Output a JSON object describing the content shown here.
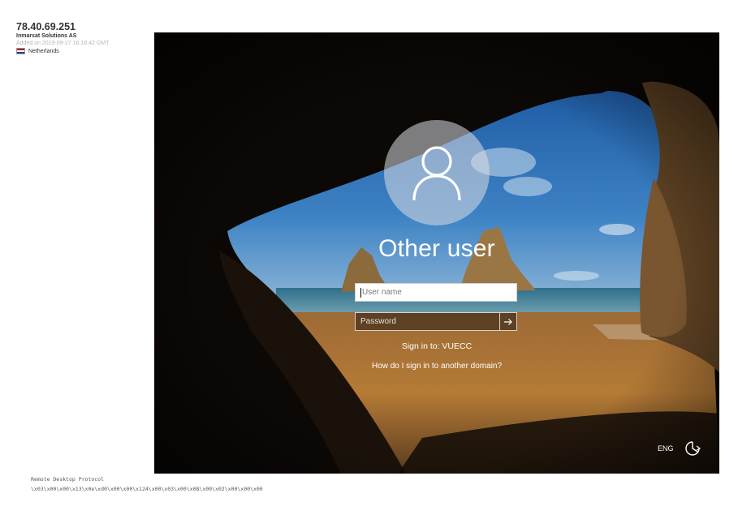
{
  "host": {
    "ip": "78.40.69.251",
    "organization": "Inmarsat Solutions AS",
    "added": "Added on 2019-09-27 16:18:42 GMT",
    "country": "Netherlands",
    "flag_icon": "netherlands-flag-icon"
  },
  "login": {
    "title": "Other user",
    "username_placeholder": "User name",
    "password_placeholder": "Password",
    "submit_icon": "arrow-right-icon",
    "sign_in_to": "Sign in to: VUECC",
    "another_domain": "How do I sign in to another domain?",
    "language": "ENG",
    "accessibility_icon": "ease-of-access-icon",
    "avatar_icon": "user-avatar-icon"
  },
  "footer": {
    "protocol": "Remote Desktop Protocol",
    "bytes": "\\x03\\x00\\x00\\x13\\x0e\\xd0\\x00\\x00\\x124\\x00\\x03\\x00\\x08\\x00\\x02\\x00\\x00\\x00"
  },
  "colors": {
    "ip_text": "#333333",
    "muted_text": "#b5b5b5",
    "screen_bg": "#0b0806",
    "sky": "#2f6fb4",
    "sand": "#a9712f",
    "rock": "#6b4a28"
  }
}
